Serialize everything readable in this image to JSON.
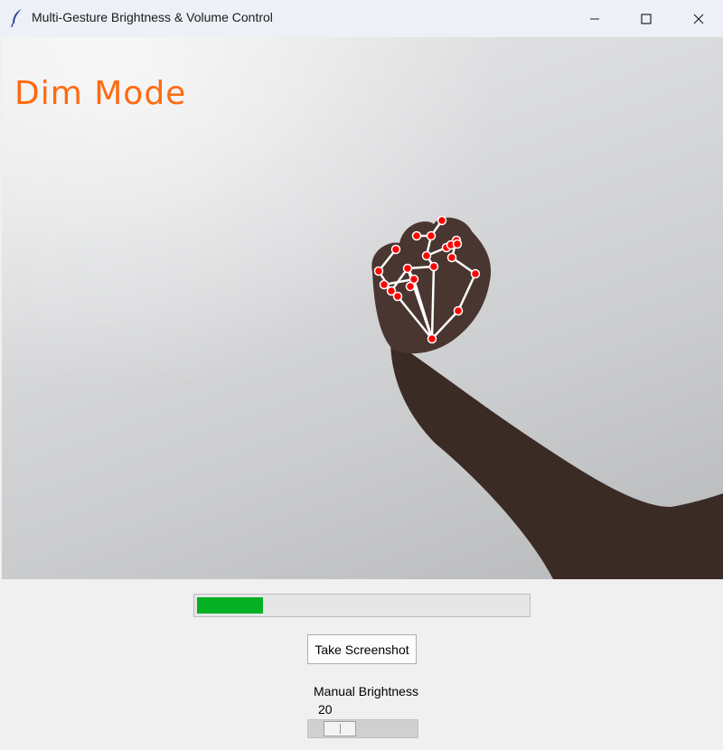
{
  "window": {
    "title": "Multi-Gesture Brightness & Volume Control",
    "app_icon": "feather-icon",
    "controls": [
      "minimize-icon",
      "maximize-icon",
      "close-icon"
    ]
  },
  "camera": {
    "overlay_text": "Dim Mode",
    "overlay_color": "#ff6a10",
    "landmark_color": "#ff0000",
    "connection_color": "#ffffff"
  },
  "brightness_bar": {
    "level_fraction": 0.2,
    "fill_color": "#06b025"
  },
  "screenshot_button": {
    "label": "Take Screenshot"
  },
  "manual_brightness": {
    "label": "Manual Brightness",
    "value": "20",
    "min": 0,
    "max": 100
  }
}
